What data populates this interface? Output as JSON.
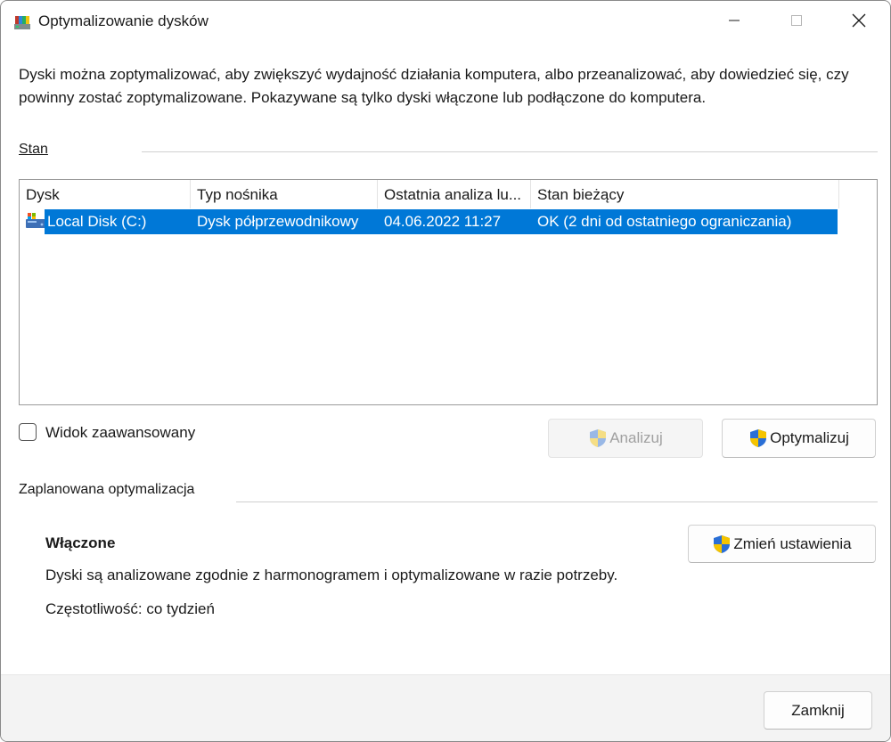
{
  "window": {
    "title": "Optymalizowanie dysków"
  },
  "description": "Dyski można zoptymalizować, aby zwiększyć wydajność działania komputera, albo przeanalizować, aby dowiedzieć się, czy powinny zostać zoptymalizowane. Pokazywane są tylko dyski włączone lub podłączone do komputera.",
  "status_group": {
    "label": "Stan"
  },
  "table": {
    "columns": [
      "Dysk",
      "Typ nośnika",
      "Ostatnia analiza lu...",
      "Stan bieżący"
    ],
    "rows": [
      {
        "disk": "Local Disk (C:)",
        "media": "Dysk półprzewodnikowy",
        "last_run": "04.06.2022 11:27",
        "status": "OK (2 dni od ostatniego ograniczania)",
        "selected": true
      }
    ]
  },
  "advanced_view": {
    "label": "Widok zaawansowany",
    "checked": false
  },
  "buttons": {
    "analyze": "Analizuj",
    "optimize": "Optymalizuj",
    "change_settings": "Zmień ustawienia",
    "close": "Zamknij"
  },
  "scheduled": {
    "label": "Zaplanowana optymalizacja",
    "state": "Włączone",
    "description": "Dyski są analizowane zgodnie z harmonogramem i optymalizowane w razie potrzeby.",
    "frequency": "Częstotliwość: co tydzień"
  },
  "colors": {
    "selection": "#0078d7",
    "shield_blue": "#2a6fd6",
    "shield_yellow": "#f5c400"
  },
  "icons": [
    "app-defrag-icon",
    "minimize-icon",
    "maximize-icon",
    "close-icon",
    "drive-icon",
    "uac-shield-icon"
  ]
}
